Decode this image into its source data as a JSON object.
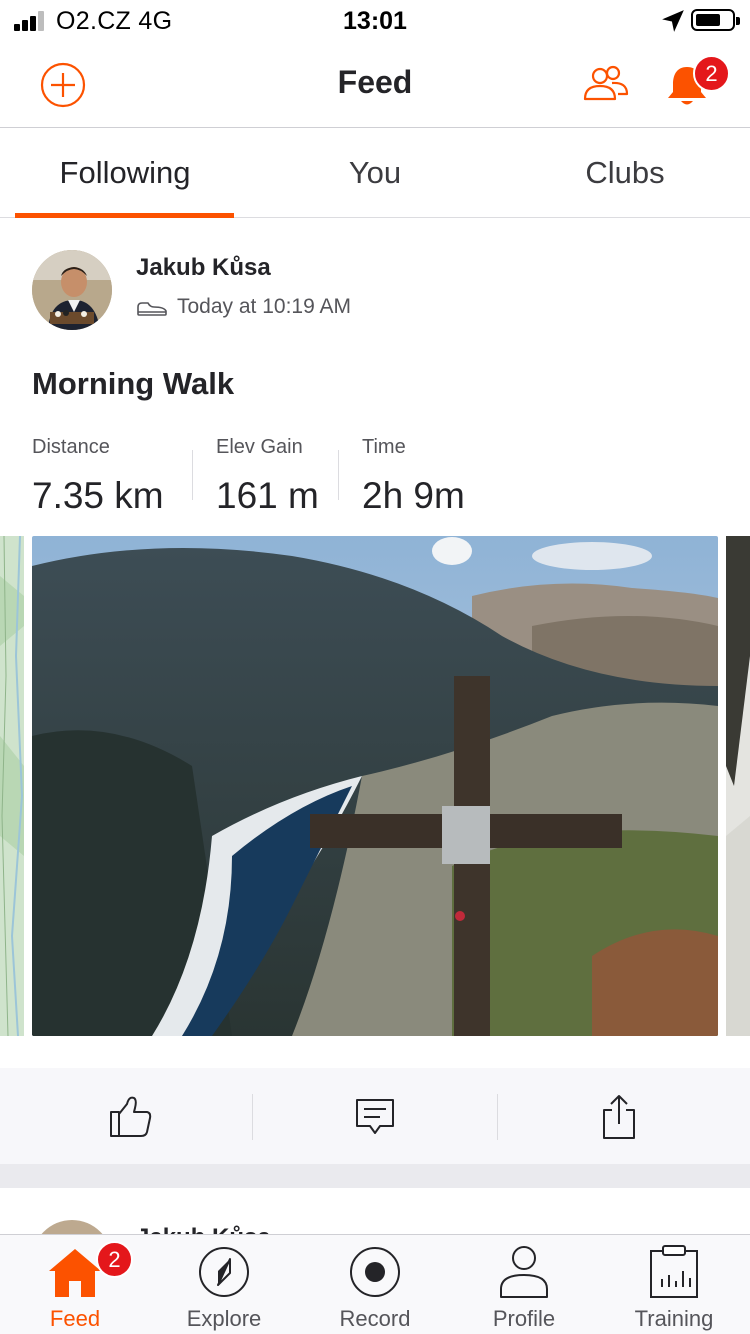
{
  "status_bar": {
    "carrier": "O2.CZ  4G",
    "time": "13:01",
    "icons": [
      "signal-icon",
      "location-arrow-icon",
      "battery-icon"
    ]
  },
  "header": {
    "title": "Feed",
    "notification_count": "2",
    "icons": [
      "add-circle-icon",
      "athletes-icon",
      "bell-icon"
    ]
  },
  "tabs": [
    {
      "label": "Following",
      "active": true
    },
    {
      "label": "You",
      "active": false
    },
    {
      "label": "Clubs",
      "active": false
    }
  ],
  "activity": {
    "athlete_name": "Jakub Kůsa",
    "timestamp": "Today at 10:19 AM",
    "sport_icon": "shoe-icon",
    "title": "Morning Walk",
    "stats": [
      {
        "label": "Distance",
        "value": "7.35 km"
      },
      {
        "label": "Elev Gain",
        "value": "161 m"
      },
      {
        "label": "Time",
        "value": "2h 9m"
      }
    ],
    "actions": [
      "like-thumb-icon",
      "comment-icon",
      "share-icon"
    ]
  },
  "next_activity": {
    "athlete_name": "Jakub Kůsa"
  },
  "tab_bar": {
    "items": [
      {
        "label": "Feed",
        "icon": "home-icon",
        "active": true,
        "badge": "2"
      },
      {
        "label": "Explore",
        "icon": "compass-icon",
        "active": false
      },
      {
        "label": "Record",
        "icon": "record-icon",
        "active": false
      },
      {
        "label": "Profile",
        "icon": "person-icon",
        "active": false
      },
      {
        "label": "Training",
        "icon": "calendar-chart-icon",
        "active": false
      }
    ]
  },
  "colors": {
    "accent": "#fc5200",
    "badge": "#e4171b",
    "text_primary": "#242428",
    "text_secondary": "#55555a"
  }
}
